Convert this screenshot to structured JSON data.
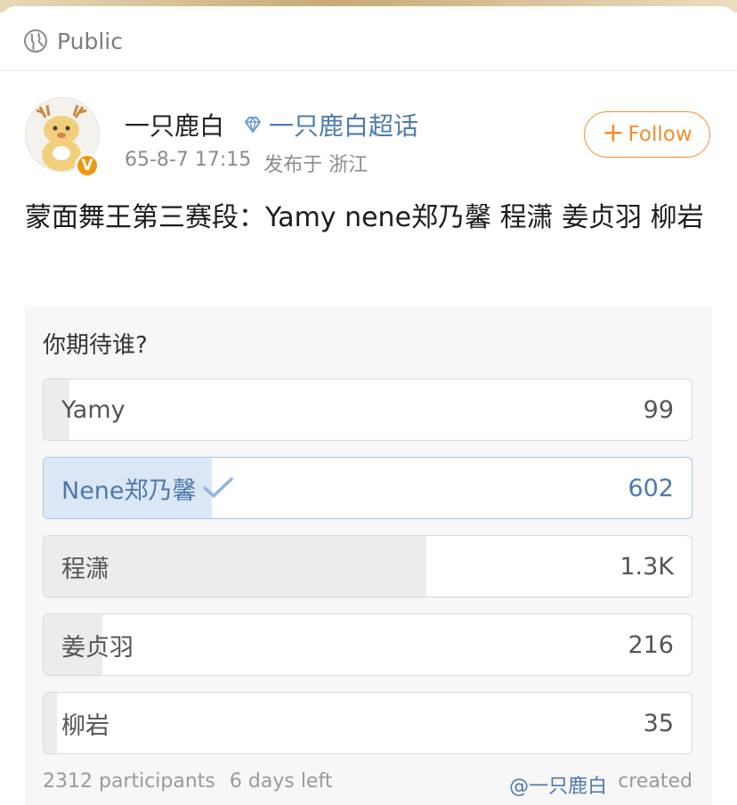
{
  "visibility": {
    "label": "Public",
    "icon": "globe-icon"
  },
  "author": {
    "name": "一只鹿白",
    "verified_badge": "V",
    "topic_label": "一只鹿白超话",
    "timestamp": "65-8-7 17:15",
    "location": "发布于 浙江"
  },
  "follow": {
    "plus": "+",
    "label": "Follow"
  },
  "post": {
    "text": "蒙面舞王第三赛段：Yamy nene郑乃馨 程潇 姜贞羽 柳岩"
  },
  "poll": {
    "question": "你期待谁?",
    "options": [
      {
        "label": "Yamy",
        "count": "99",
        "fill_fraction": 0.04,
        "selected": false
      },
      {
        "label": "Nene郑乃馨",
        "count": "602",
        "fill_fraction": 0.26,
        "selected": true
      },
      {
        "label": "程潇",
        "count": "1.3K",
        "fill_fraction": 0.59,
        "selected": false
      },
      {
        "label": "姜贞羽",
        "count": "216",
        "fill_fraction": 0.09,
        "selected": false
      },
      {
        "label": "柳岩",
        "count": "35",
        "fill_fraction": 0.02,
        "selected": false
      }
    ],
    "participants": "2312 participants",
    "time_left": "6 days left",
    "creator": "@一只鹿白",
    "created_label": "created"
  },
  "colors": {
    "accent_blue": "#4f79ab",
    "follow_orange": "#f08f2c",
    "verified_orange": "#f0960c"
  }
}
